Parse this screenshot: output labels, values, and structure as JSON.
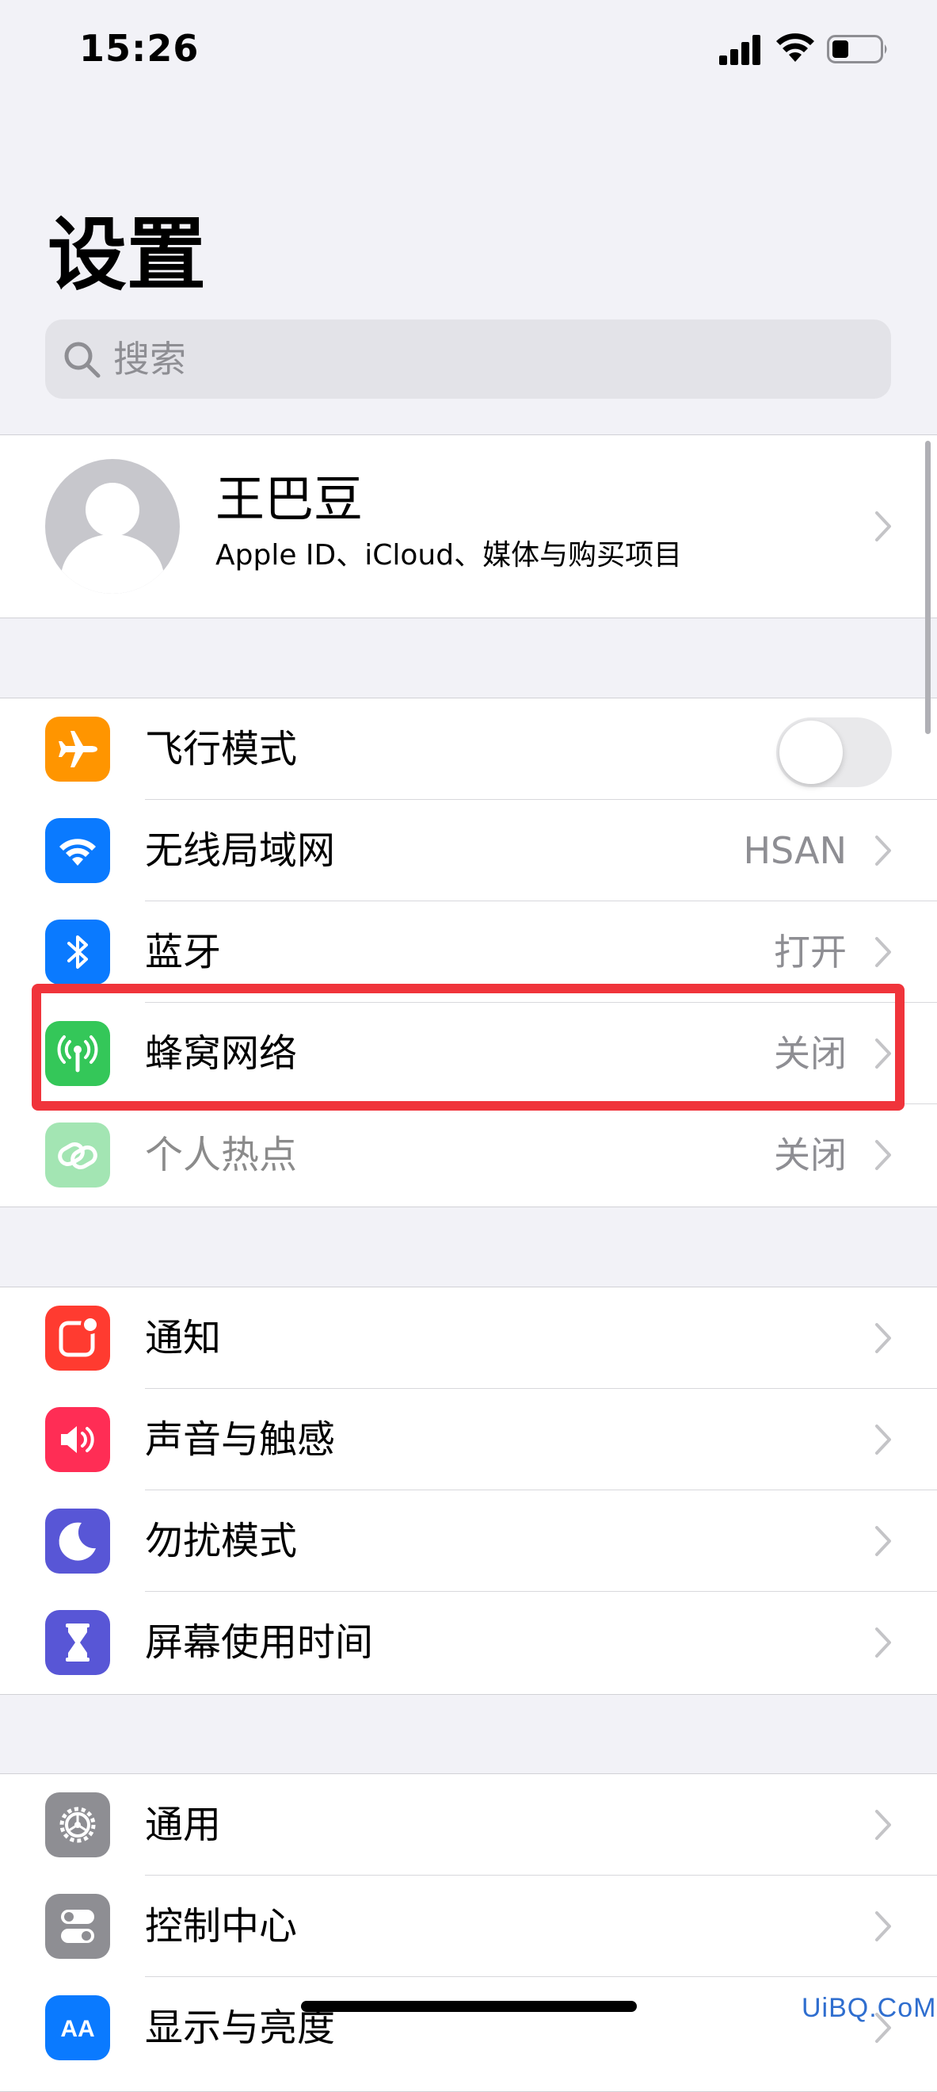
{
  "status_bar": {
    "time": "15:26"
  },
  "header": {
    "title": "设置"
  },
  "search": {
    "placeholder": "搜索"
  },
  "profile": {
    "name": "王巴豆",
    "subtitle": "Apple ID、iCloud、媒体与购买项目"
  },
  "connectivity": {
    "airplane": {
      "label": "飞行模式",
      "toggle_on": false,
      "icon": "airplane-icon",
      "color": "#ff9500"
    },
    "wifi": {
      "label": "无线局域网",
      "value": "HSAN",
      "icon": "wifi-icon",
      "color": "#0a7aff"
    },
    "bluetooth": {
      "label": "蓝牙",
      "value": "打开",
      "icon": "bluetooth-icon",
      "color": "#0a7aff"
    },
    "cellular": {
      "label": "蜂窝网络",
      "value": "关闭",
      "icon": "antenna-icon",
      "color": "#34c759",
      "highlighted": true
    },
    "hotspot": {
      "label": "个人热点",
      "value": "关闭",
      "icon": "link-icon",
      "color": "#34c759",
      "disabled": true
    }
  },
  "notifications_group": {
    "notifications": {
      "label": "通知",
      "icon": "notification-icon",
      "color": "#ff3b30"
    },
    "sounds": {
      "label": "声音与触感",
      "icon": "speaker-icon",
      "color": "#ff2d55"
    },
    "dnd": {
      "label": "勿扰模式",
      "icon": "moon-icon",
      "color": "#5856d6"
    },
    "screen_time": {
      "label": "屏幕使用时间",
      "icon": "hourglass-icon",
      "color": "#5856d6"
    }
  },
  "general_group": {
    "general": {
      "label": "通用",
      "icon": "gear-icon",
      "color": "#8e8e93"
    },
    "control_center": {
      "label": "控制中心",
      "icon": "switches-icon",
      "color": "#8e8e93"
    },
    "display": {
      "label": "显示与亮度",
      "icon": "display-icon",
      "color": "#0a7aff"
    }
  },
  "watermark": "UiBQ.CoM"
}
